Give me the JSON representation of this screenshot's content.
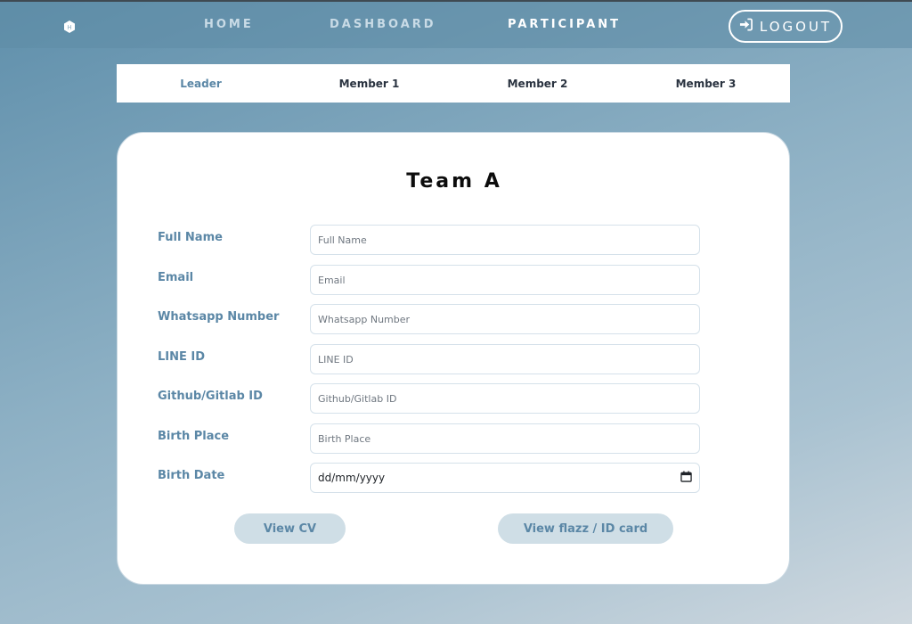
{
  "nav": {
    "home": "HOME",
    "dashboard": "DASHBOARD",
    "participant": "PARTICIPANT",
    "logout": "LOGOUT"
  },
  "tabs": [
    {
      "label": "Leader",
      "active": true
    },
    {
      "label": "Member 1",
      "active": false
    },
    {
      "label": "Member 2",
      "active": false
    },
    {
      "label": "Member 3",
      "active": false
    }
  ],
  "card": {
    "title": "Team A",
    "fields": [
      {
        "label": "Full Name",
        "placeholder": "Full Name"
      },
      {
        "label": "Email",
        "placeholder": "Email"
      },
      {
        "label": "Whatsapp Number",
        "placeholder": "Whatsapp Number"
      },
      {
        "label": "LINE ID",
        "placeholder": "LINE ID"
      },
      {
        "label": "Github/Gitlab ID",
        "placeholder": "Github/Gitlab ID"
      },
      {
        "label": "Birth Place",
        "placeholder": "Birth Place"
      },
      {
        "label": "Birth Date",
        "placeholder": "dd/mm/yyyy"
      }
    ],
    "view_cv": "View CV",
    "view_flazz": "View flazz / ID card"
  },
  "colors": {
    "accent": "#5b87a6",
    "button_bg": "#cfdee6",
    "nav_inactive": "#c9dbe6"
  },
  "icons": {
    "logo": "hexagon-logo-icon",
    "logout": "sign-in-arrow-icon",
    "date": "calendar-icon"
  }
}
